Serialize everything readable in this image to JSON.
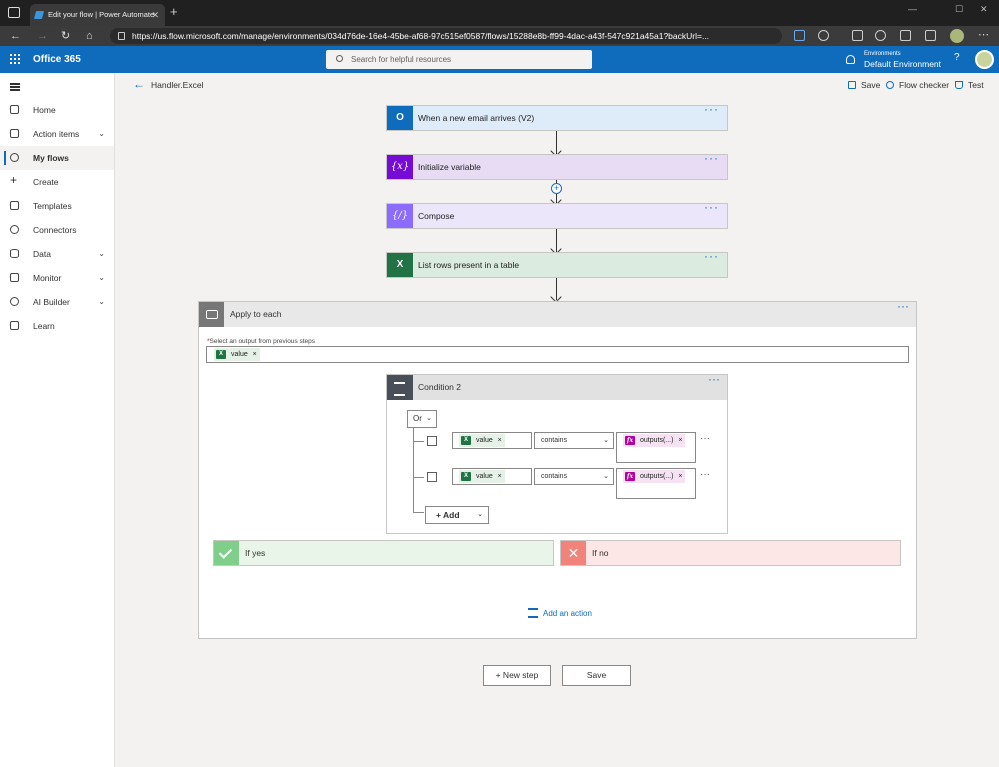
{
  "browser": {
    "tab_title": "Edit your flow | Power Automate",
    "url": "https://us.flow.microsoft.com/manage/environments/034d76de-16e4-45be-af68-97c515ef0587/flows/15288e8b-ff99-4dac-a43f-547c921a45a1?backUrl=..."
  },
  "header": {
    "brand": "Office 365",
    "search_placeholder": "Search for helpful resources",
    "env_label": "Environments",
    "env_value": "Default Environment",
    "help": "?"
  },
  "nav": {
    "items": [
      {
        "label": "Home"
      },
      {
        "label": "Action items"
      },
      {
        "label": "My flows"
      },
      {
        "label": "Create"
      },
      {
        "label": "Templates"
      },
      {
        "label": "Connectors"
      },
      {
        "label": "Data"
      },
      {
        "label": "Monitor"
      },
      {
        "label": "AI Builder"
      },
      {
        "label": "Learn"
      }
    ]
  },
  "cmdbar": {
    "flow_name": "Handler.Excel",
    "save": "Save",
    "flow_checker": "Flow checker",
    "test": "Test"
  },
  "steps": [
    {
      "title": "When a new email arrives (V2)",
      "icon": "outlook-icon",
      "color": "#0f6cbd"
    },
    {
      "title": "Initialize variable",
      "icon": "variable-icon",
      "glyph": "{x}",
      "color": "#770bd6"
    },
    {
      "title": "Compose",
      "icon": "compose-icon",
      "glyph": "{∕}",
      "color": "#8c6cff"
    },
    {
      "title": "List rows present in a table",
      "icon": "excel-icon",
      "color": "#217346"
    }
  ],
  "apply_each": {
    "title": "Apply to each",
    "select_label": "Select an output from previous steps",
    "token": "value"
  },
  "condition": {
    "title": "Condition 2",
    "group_operator": "Or",
    "rows": [
      {
        "left": "value",
        "operator": "contains",
        "right": "outputs(...)"
      },
      {
        "left": "value",
        "operator": "contains",
        "right": "outputs(...)"
      }
    ],
    "add_label": "Add"
  },
  "branches": {
    "yes": "If yes",
    "no": "If no"
  },
  "add_action": "Add an action",
  "footer": {
    "new_step": "+ New step",
    "save": "Save"
  },
  "more": "···",
  "colors": {
    "accent": "#0f6cbd",
    "yes": "#7fcf8a",
    "no": "#f1837b"
  }
}
